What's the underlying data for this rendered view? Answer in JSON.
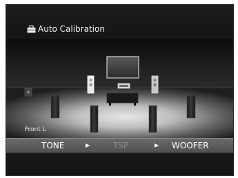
{
  "header": {
    "title": "Auto Calibration",
    "title_icon": "toolbox-icon"
  },
  "stage": {
    "position_label": "Front L",
    "active_speaker": "front-left-speaker"
  },
  "menu": {
    "items": [
      {
        "label": "TONE",
        "state": "enabled"
      },
      {
        "label": "TSP",
        "state": "disabled"
      },
      {
        "label": "WOOFER",
        "state": "enabled"
      }
    ],
    "separator_icon": "play-arrow-icon"
  },
  "colors": {
    "screen_bg": "#101010",
    "menu_bar": "#5d5d5d",
    "text": "#ffffff",
    "text_disabled": "#8c8c8c"
  }
}
